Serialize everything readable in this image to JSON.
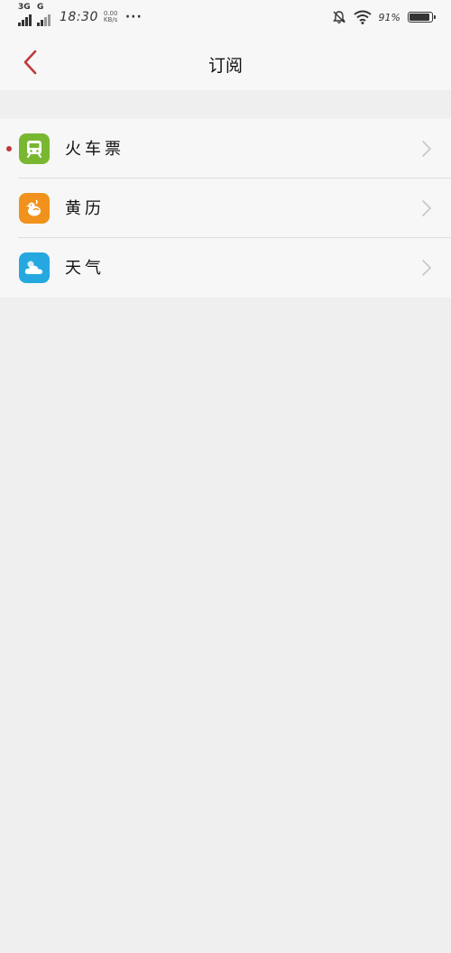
{
  "status_bar": {
    "network_1": "3G",
    "network_2": "G",
    "time": "18:30",
    "speed_top": "0.00",
    "speed_bottom": "KB/s",
    "more": "···",
    "battery_percent": "91%",
    "battery_level": 0.91
  },
  "header": {
    "title": "订阅"
  },
  "subscriptions": [
    {
      "label": "火车票",
      "icon": "train-icon",
      "color": "#7ab731",
      "unread": true
    },
    {
      "label": "黄历",
      "icon": "almanac-bird-icon",
      "color": "#f0921b",
      "unread": false
    },
    {
      "label": "天气",
      "icon": "weather-cloud-icon",
      "color": "#25a8e0",
      "unread": false
    }
  ],
  "colors": {
    "accent": "#c0393b",
    "background": "#efefef",
    "row_background": "#f7f7f7"
  }
}
